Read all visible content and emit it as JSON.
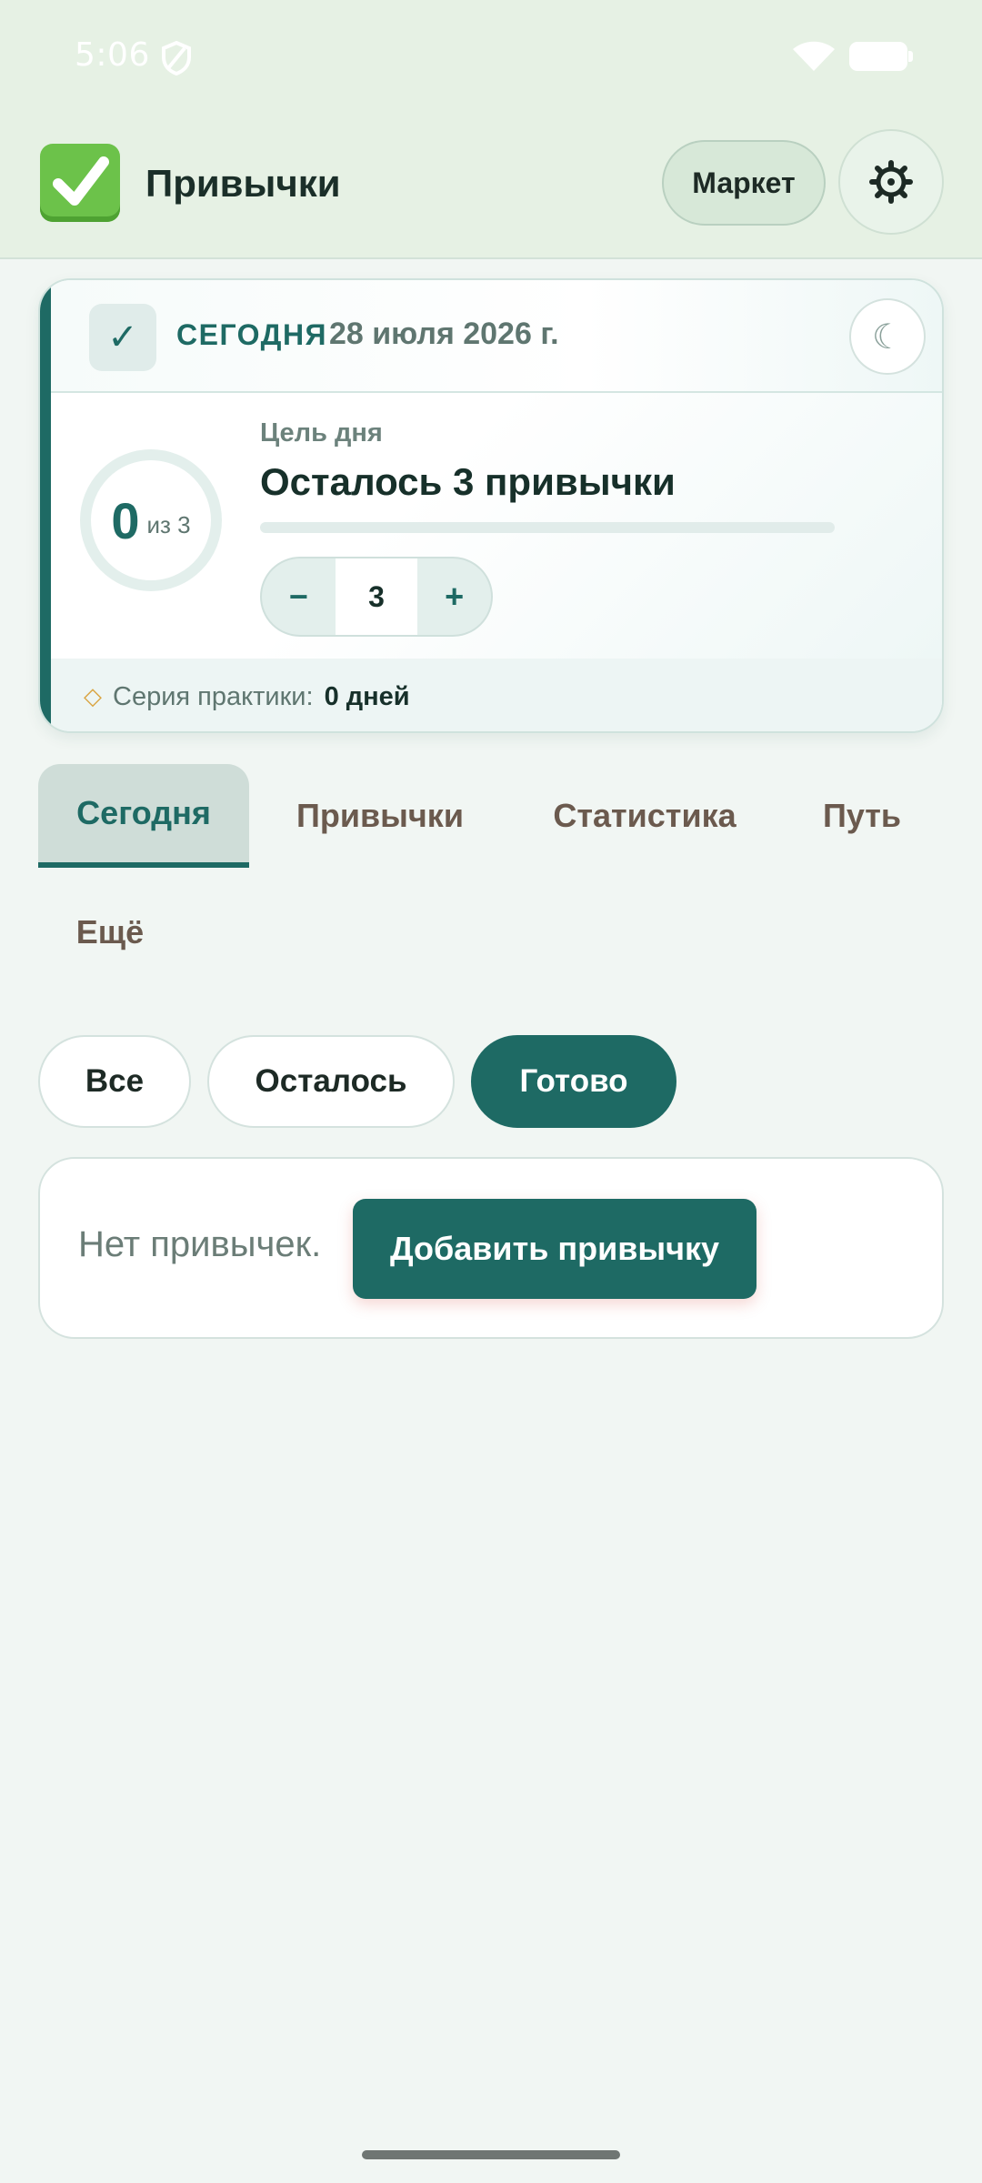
{
  "status_bar": {
    "time": "5:06"
  },
  "header": {
    "title": "Привычки",
    "market_label": "Маркет"
  },
  "today_card": {
    "label": "СЕГОДНЯ",
    "date": "28 июля 2026 г.",
    "done_count": "0",
    "of_total": "из 3",
    "goal_caption": "Цель дня",
    "goal_title": "Осталось 3 привычки",
    "goal_progress": 0,
    "stepper_minus": "−",
    "stepper_value": "3",
    "stepper_plus": "+",
    "streak_label": "Серия практики:",
    "streak_value": "0 дней"
  },
  "tabs": [
    {
      "label": "Сегодня",
      "active": true
    },
    {
      "label": "Привычки"
    },
    {
      "label": "Статистика"
    },
    {
      "label": "Путь"
    },
    {
      "label": "Ещё"
    }
  ],
  "filters": [
    {
      "label": "Все"
    },
    {
      "label": "Осталось"
    },
    {
      "label": "Готово",
      "active": true
    }
  ],
  "empty_state": {
    "text": "Нет привычек.",
    "add_button": "Добавить привычку"
  },
  "colors": {
    "accent": "#1e6a64",
    "header_bg": "#e6f1e4",
    "page_bg": "#f1f6f3"
  }
}
